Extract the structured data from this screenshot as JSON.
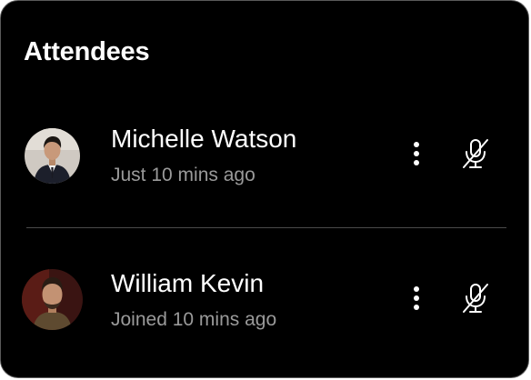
{
  "panel": {
    "title": "Attendees"
  },
  "attendees": [
    {
      "name": "Michelle Watson",
      "status": "Just 10 mins ago",
      "muted": true
    },
    {
      "name": "William Kevin",
      "status": "Joined 10 mins ago",
      "muted": true
    }
  ],
  "icons": {
    "more": "more-vertical-icon",
    "mic": "mic-off-icon"
  },
  "colors": {
    "background": "#000000",
    "text_primary": "#ffffff",
    "text_secondary": "#9a9a9a",
    "divider": "#4a4a4a"
  }
}
